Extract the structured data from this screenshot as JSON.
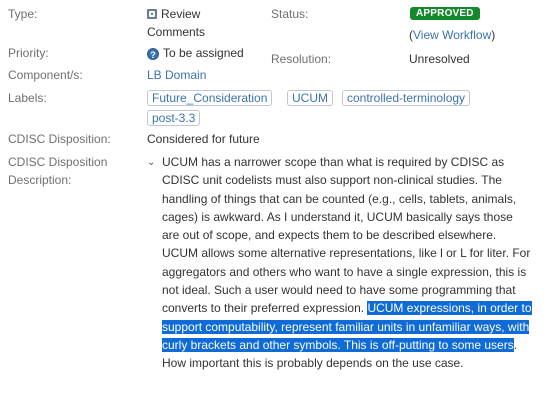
{
  "fields": {
    "type_label": "Type:",
    "type_value": "Review Comments",
    "status_label": "Status:",
    "status_value": "APPROVED",
    "view_workflow_open": "(",
    "view_workflow_link": "View Workflow",
    "view_workflow_close": ")",
    "priority_label": "Priority:",
    "priority_value": "To be assigned",
    "resolution_label": "Resolution:",
    "resolution_value": "Unresolved",
    "component_label": "Component/s:",
    "component_value": "LB Domain",
    "labels_label": "Labels:",
    "labels": [
      "Future_Consideration",
      "UCUM",
      "controlled-terminology",
      "post-3.3"
    ],
    "disposition_label": "CDISC Disposition:",
    "disposition_value": "Considered for future",
    "disposition_desc_label_1": "CDISC Disposition",
    "disposition_desc_label_2": "Description:"
  },
  "description": {
    "text_before": "UCUM has a narrower scope than what is required by CDISC as CDISC unit codelists must also support non-clinical studies. The handling of things that can be counted (e.g., cells, tablets, animals, cages) is awkward. As I understand it, UCUM basically says those are out of scope, and expects them to be described elsewhere. UCUM allows some alternative representations, like l or L for liter. For aggregators and others who want to have a single expression, this is not ideal. Such a user would need to have some programming that converts to their preferred expression. ",
    "text_selected": "UCUM expressions, in order to support computability, represent familiar units in unfamiliar ways, with curly brackets and other symbols. This is off-putting to some users",
    "text_after": ". How important this is probably depends on the use case."
  },
  "icons": {
    "type_icon": "review-comments-icon",
    "priority_icon": "help-question-icon",
    "collapse_icon": "chevron-down-icon"
  },
  "colors": {
    "status_badge": "#14892c",
    "link": "#3b73af",
    "selection": "#0f6bd6"
  }
}
